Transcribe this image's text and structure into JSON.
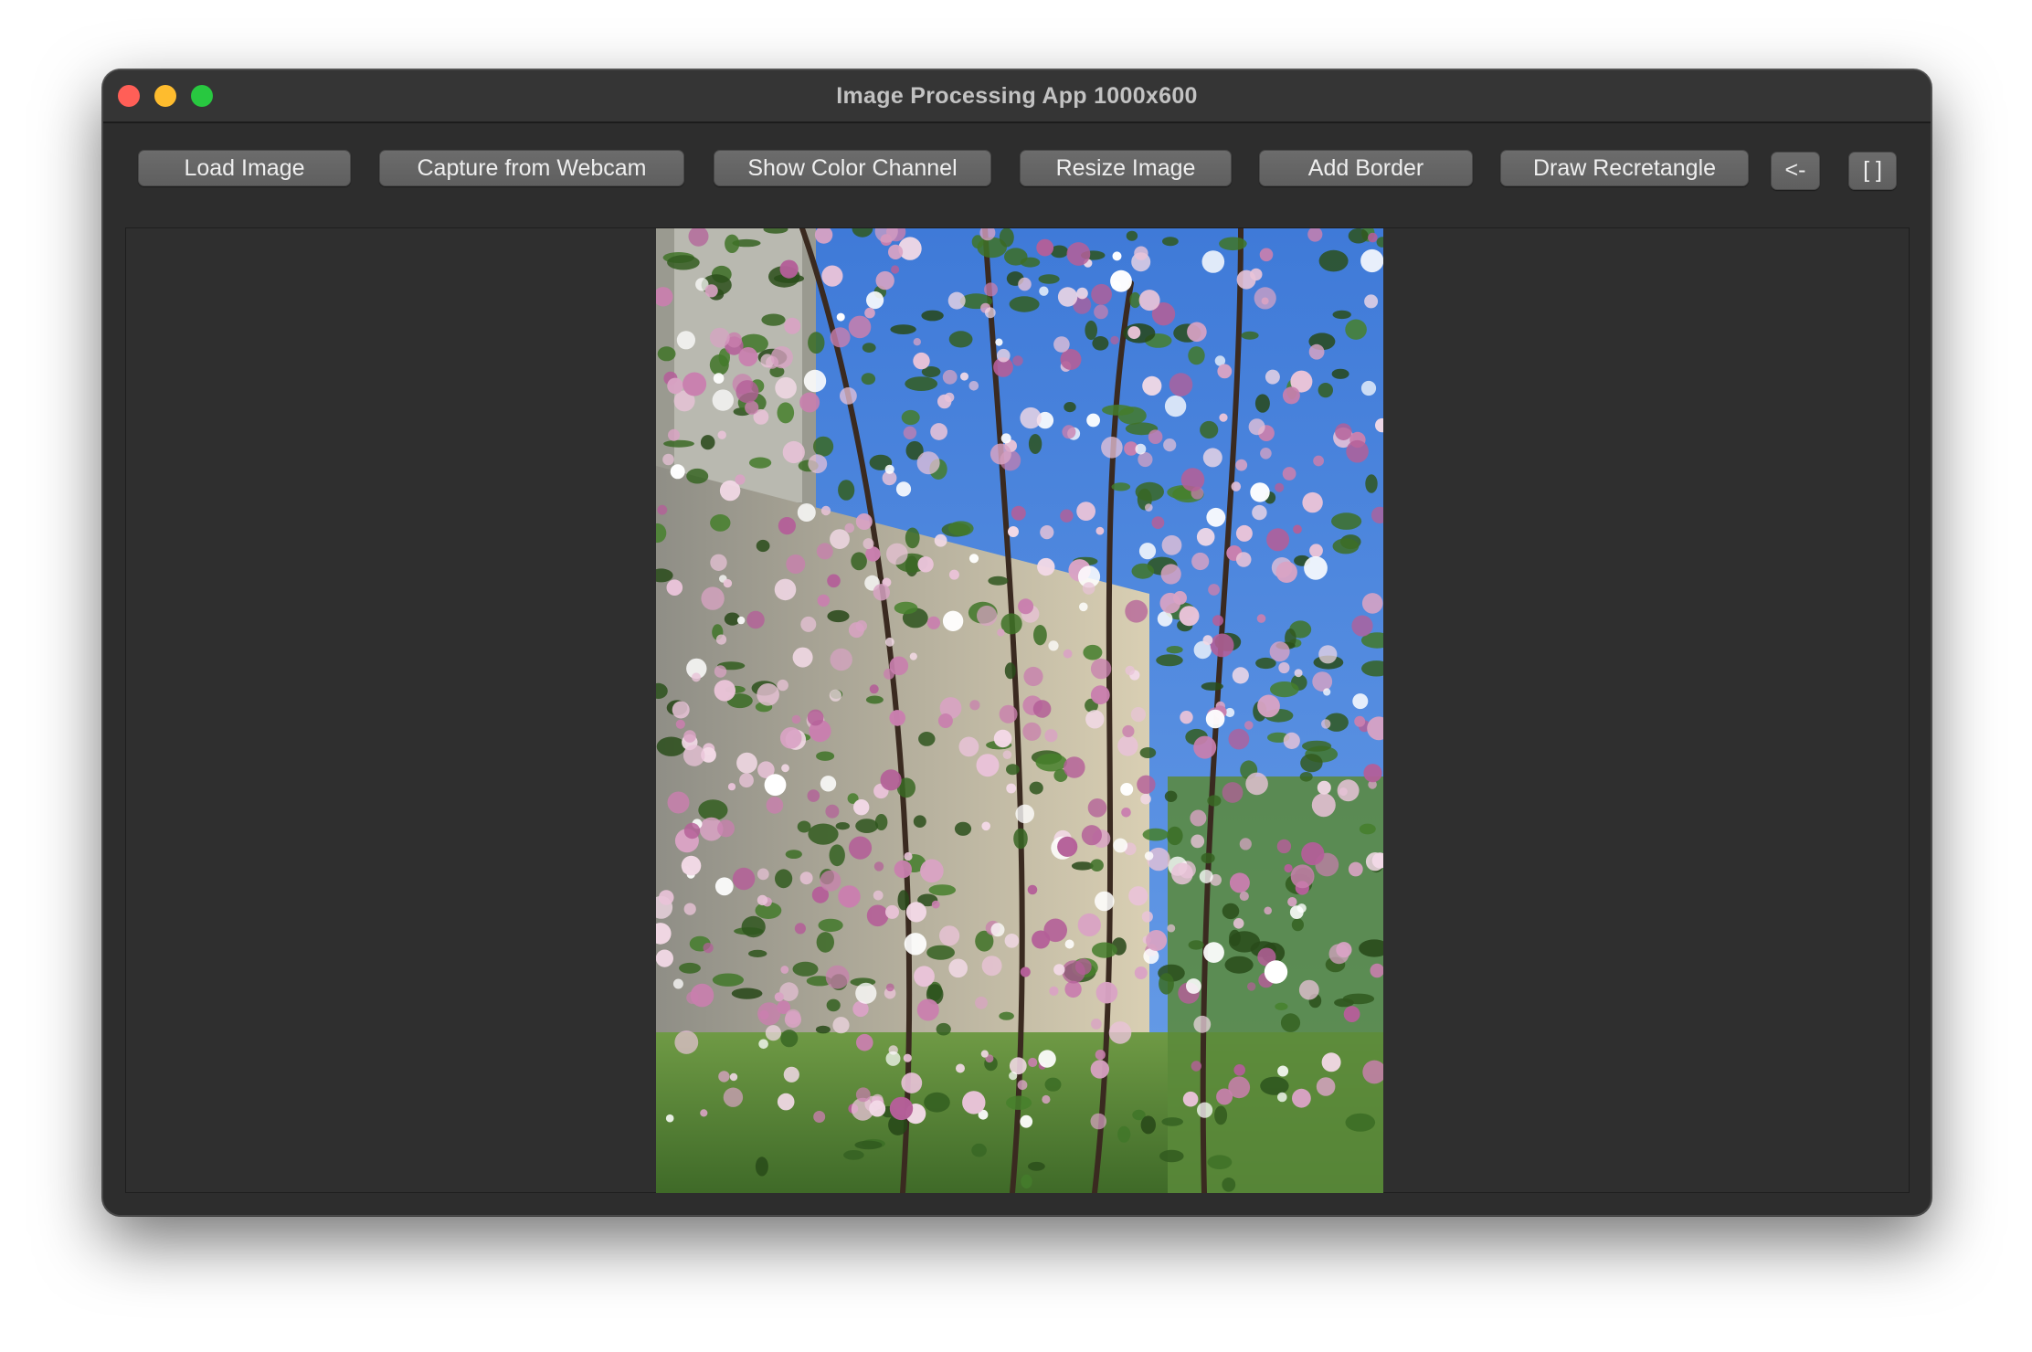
{
  "window": {
    "title": "Image Processing App 1000x600"
  },
  "toolbar": {
    "load_image": "Load Image",
    "capture_webcam": "Capture from Webcam",
    "show_color_channel": "Show Color Channel",
    "resize_image": "Resize Image",
    "add_border": "Add Border",
    "draw_rectangle": "Draw Recretangle",
    "undo": "<-",
    "crop": "[ ]"
  },
  "image": {
    "subject": "flowering crabapple tree with pink blossoms",
    "colors": {
      "sky": "#4d86e0",
      "building": "#d8cdb0",
      "foliage": "#3f5a2a",
      "blossom": "#d9a9c8",
      "grass": "#5e8a3a"
    }
  }
}
